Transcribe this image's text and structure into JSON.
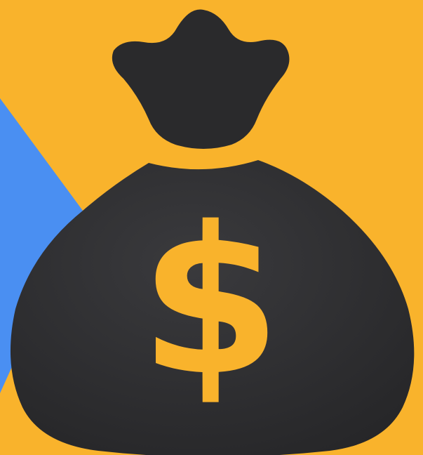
{
  "icon": {
    "name": "money-bag-icon",
    "symbol": "$",
    "colors": {
      "background": "#F9B32C",
      "accent_triangle": "#4A8FF2",
      "bag": "#2A2A2C",
      "bag_highlight": "#3A3A3D",
      "symbol": "#F9B32C"
    }
  }
}
